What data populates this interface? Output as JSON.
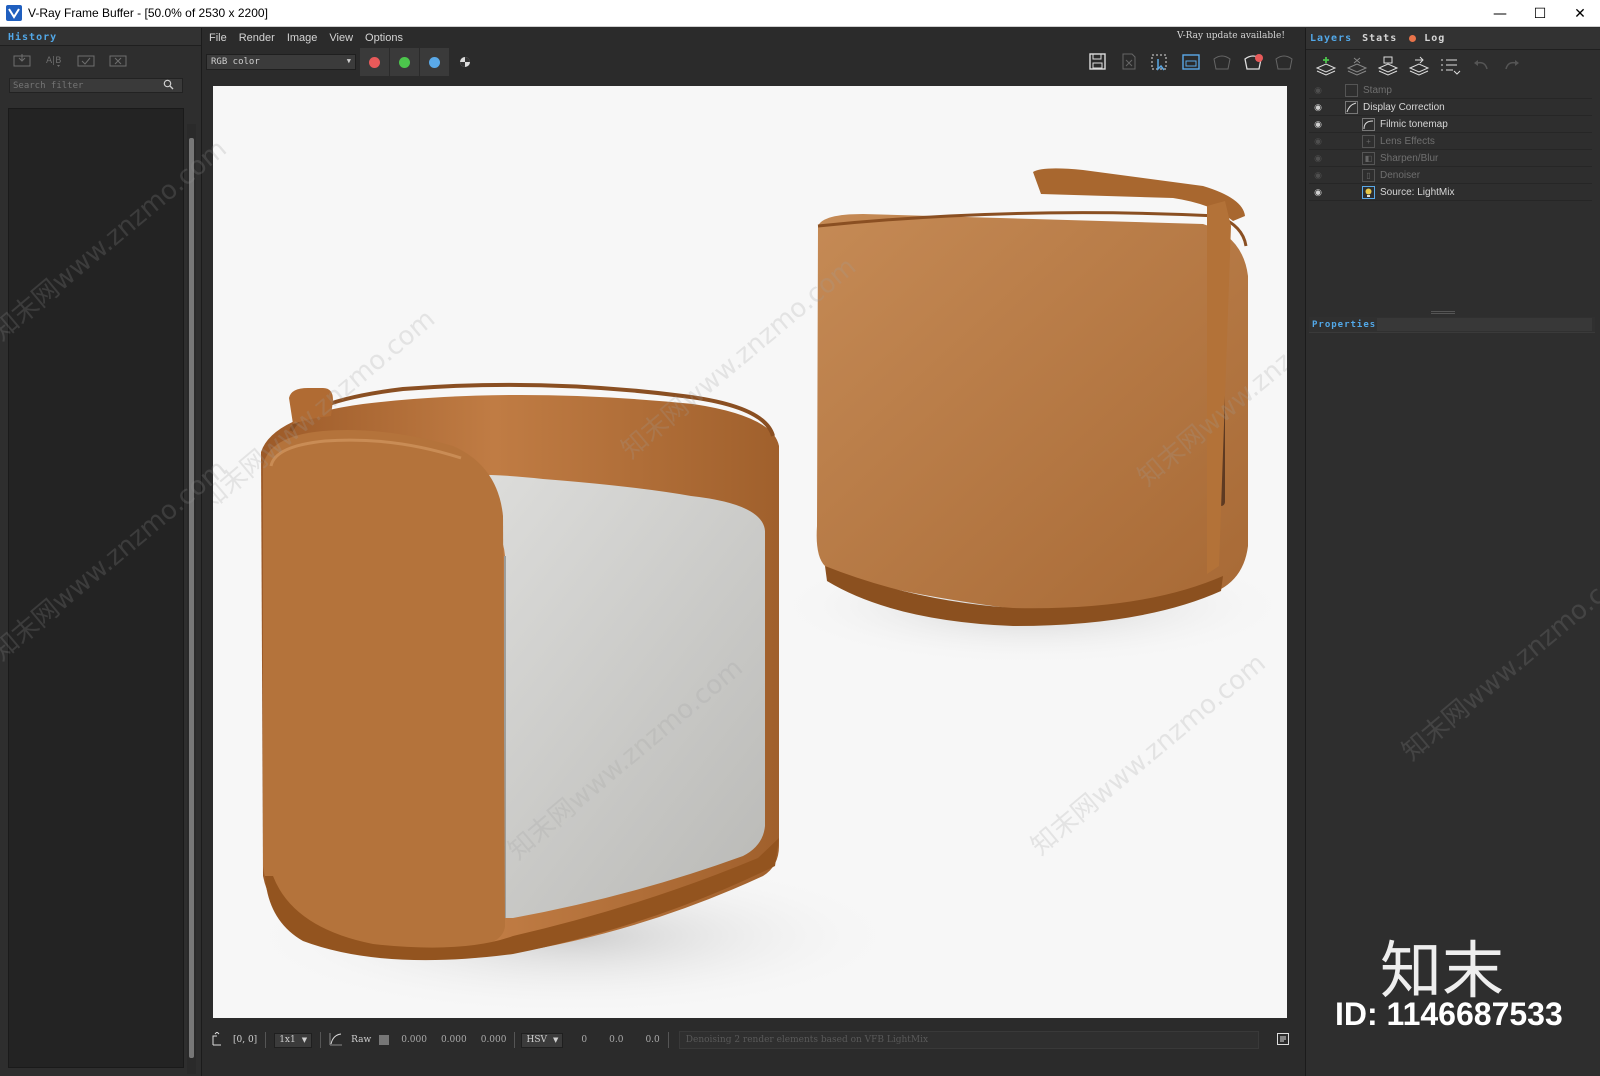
{
  "window": {
    "title": "V-Ray Frame Buffer - [50.0% of 2530 x 2200]",
    "minimize": "—",
    "maximize": "☐",
    "close": "✕"
  },
  "history_panel": {
    "tab": "History",
    "search_placeholder": "Search filter",
    "tools": [
      "save-history-icon",
      "ab-compare-icon",
      "load-history-icon",
      "delete-history-icon"
    ]
  },
  "menu": [
    "File",
    "Render",
    "Image",
    "View",
    "Options"
  ],
  "update_note": "V-Ray update available!",
  "toolbar": {
    "channel": "RGB color",
    "channel_buttons": [
      {
        "name": "red-channel-button",
        "color": "#e85a5a"
      },
      {
        "name": "green-channel-button",
        "color": "#4cc64c"
      },
      {
        "name": "blue-channel-button",
        "color": "#5aa9e8"
      }
    ],
    "right_icons": [
      "save-image-icon",
      "clear-image-icon",
      "region-render-icon",
      "lens-render-icon",
      "render-last-icon",
      "stop-render-icon",
      "interactive-render-icon"
    ]
  },
  "statusbar": {
    "coords": "[0, 0]",
    "zoom": "1x1",
    "mode": "Raw",
    "r": "0.000",
    "g": "0.000",
    "b": "0.000",
    "color_space": "HSV",
    "h": "0",
    "s": "0.0",
    "v": "0.0",
    "message": "Denoising 2 render elements based on VFB LightMix"
  },
  "right_panel": {
    "tabs": [
      "Layers",
      "Stats",
      "Log"
    ],
    "layers": [
      {
        "name": "Stamp",
        "visible": false,
        "indent": 1,
        "icon": "stamp-icon"
      },
      {
        "name": "Display Correction",
        "visible": true,
        "indent": 1,
        "icon": "curve-icon"
      },
      {
        "name": "Filmic tonemap",
        "visible": true,
        "indent": 2,
        "icon": "tonemap-icon"
      },
      {
        "name": "Lens Effects",
        "visible": false,
        "indent": 2,
        "icon": "lens-icon"
      },
      {
        "name": "Sharpen/Blur",
        "visible": false,
        "indent": 2,
        "icon": "sharpen-icon"
      },
      {
        "name": "Denoiser",
        "visible": false,
        "indent": 2,
        "icon": "denoiser-icon"
      },
      {
        "name": "Source: LightMix",
        "visible": true,
        "indent": 2,
        "icon": "lightmix-icon"
      }
    ],
    "properties_label": "Properties"
  },
  "watermark": {
    "logo": "知末",
    "id": "ID: 1146687533",
    "repeat": "知末网www.znzmo.com"
  }
}
